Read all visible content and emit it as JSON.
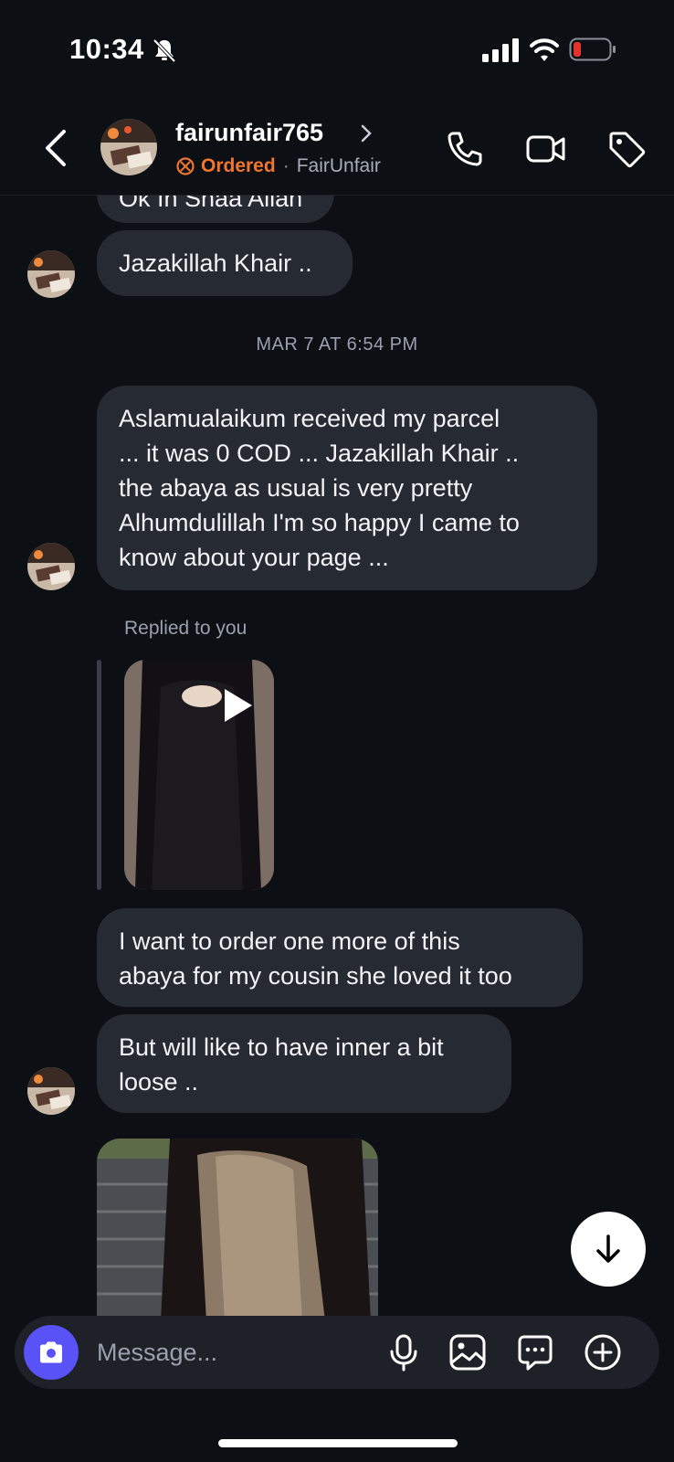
{
  "status_bar": {
    "time": "10:34",
    "icons": [
      "bell-slash-icon",
      "signal-icon",
      "wifi-icon",
      "battery-low-icon"
    ],
    "battery_color": "#e5322d"
  },
  "header": {
    "username": "fairunfair765",
    "order_status": "Ordered",
    "separator": "·",
    "shop_name": "FairUnfair",
    "accent_color": "#f0762f",
    "actions": [
      "phone-icon",
      "video-camera-icon",
      "tag-icon"
    ]
  },
  "messages": {
    "partial_text": "Ok In Shaa Allah",
    "msg_1": "Jazakillah Khair ..",
    "timestamp": "MAR 7 AT 6:54 PM",
    "msg_2_lines": [
      "Aslamualaikum received  my parcel",
      "... it was 0 COD ... Jazakillah Khair ..",
      "the abaya as usual is very pretty",
      "Alhumdulillah I'm so happy I came to",
      "know about your page ..."
    ],
    "replied_label": "Replied to you",
    "msg_3_lines": [
      "I want to order one more of this",
      "abaya for my cousin she loved it too"
    ],
    "msg_4_lines": [
      "But will like to have inner a bit",
      "loose .."
    ]
  },
  "composer": {
    "placeholder": "Message...",
    "icons": [
      "camera-icon",
      "microphone-icon",
      "gallery-icon",
      "sticker-icon",
      "plus-icon"
    ],
    "camera_color": "#5852f7"
  }
}
